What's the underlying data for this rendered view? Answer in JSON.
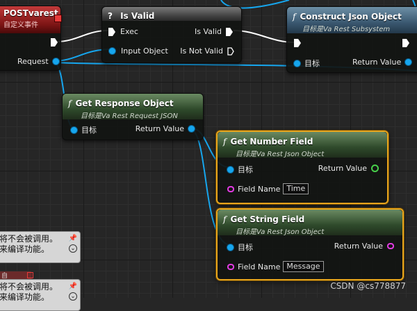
{
  "nodes": {
    "post_event": {
      "title": "POSTvarest",
      "subtitle": "自定义事件",
      "request_pin": "Request"
    },
    "is_valid": {
      "title": "Is Valid",
      "exec_pin": "Exec",
      "input_pin": "Input Object",
      "out_valid": "Is Valid",
      "out_not_valid": "Is Not Valid"
    },
    "construct_json": {
      "title": "Construct Json Object",
      "subtitle": "目标是Va Rest Subsystem",
      "target_pin": "目标",
      "return_pin": "Return Value"
    },
    "get_response": {
      "title": "Get Response Object",
      "subtitle": "目标是Va Rest Request JSON",
      "target_pin": "目标",
      "return_pin": "Return Value"
    },
    "get_number": {
      "title": "Get Number Field",
      "subtitle": "目标是Va Rest Json Object",
      "target_pin": "目标",
      "return_pin": "Return Value",
      "field_name_label": "Field Name",
      "field_name_value": "Time"
    },
    "get_string": {
      "title": "Get String Field",
      "subtitle": "目标是Va Rest Json Object",
      "target_pin": "目标",
      "return_pin": "Return Value",
      "field_name_label": "Field Name",
      "field_name_value": "Message"
    }
  },
  "comments": [
    {
      "lines": [
        "将不会被调用。",
        "来编译功能。"
      ]
    },
    {
      "lines": [
        "将不会被调用。",
        "来编译功能。"
      ],
      "header": "自"
    }
  ],
  "icons": {
    "function": "function-icon",
    "question": "question-icon",
    "pin": "pushpin-icon"
  },
  "colors": {
    "exec_wire": "#ffffff",
    "object_wire": "#16a6ee",
    "selection": "#e8a51c",
    "float_pin": "#47d04a",
    "name_pin": "#e23be2"
  },
  "watermark": "CSDN @cs778877"
}
